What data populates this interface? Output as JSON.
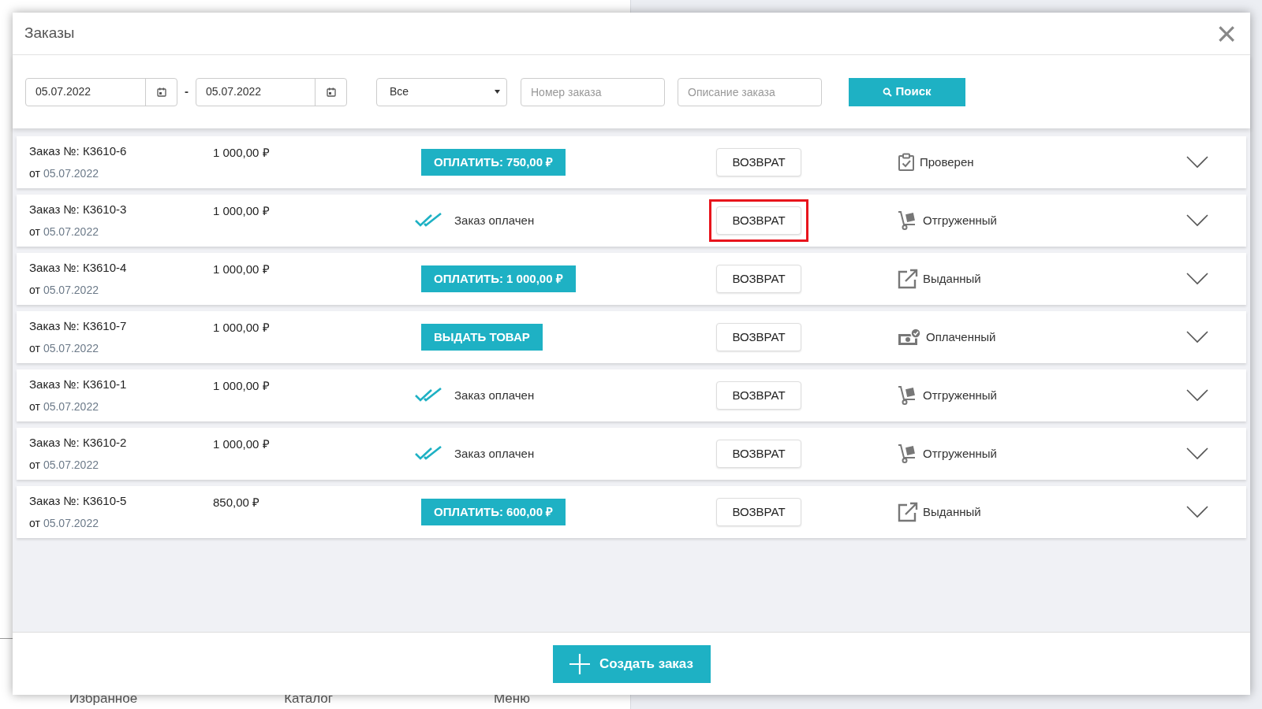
{
  "background_nav": [
    "Избранное",
    "Каталог",
    "Меню"
  ],
  "dialog": {
    "title": "Заказы",
    "close": "×"
  },
  "filters": {
    "date_from": "05.07.2022",
    "separator": "-",
    "date_to": "05.07.2022",
    "status_select": "Все",
    "order_number": {
      "placeholder": "Номер заказа"
    },
    "order_description": {
      "placeholder": "Описание заказа"
    },
    "search_button": "Поиск"
  },
  "orders": [
    {
      "number_label": "Заказ №: К3610-6",
      "date_prefix": "от",
      "date": "05.07.2022",
      "amount": "1 000,00 ₽",
      "action": {
        "kind": "pay",
        "label": "ОПЛАТИТЬ: 750,00 ₽"
      },
      "return_button": "ВОЗВРАТ",
      "highlighted": false,
      "status": {
        "kind": "checked",
        "label": "Проверен"
      }
    },
    {
      "number_label": "Заказ №: К3610-3",
      "date_prefix": "от",
      "date": "05.07.2022",
      "amount": "1 000,00 ₽",
      "action": {
        "kind": "paid",
        "label": "Заказ оплачен"
      },
      "return_button": "ВОЗВРАТ",
      "highlighted": true,
      "status": {
        "kind": "shipped",
        "label": "Отгруженный"
      }
    },
    {
      "number_label": "Заказ №: К3610-4",
      "date_prefix": "от",
      "date": "05.07.2022",
      "amount": "1 000,00 ₽",
      "action": {
        "kind": "pay",
        "label": "ОПЛАТИТЬ: 1 000,00 ₽"
      },
      "return_button": "ВОЗВРАТ",
      "highlighted": false,
      "status": {
        "kind": "issued",
        "label": "Выданный"
      }
    },
    {
      "number_label": "Заказ №: К3610-7",
      "date_prefix": "от",
      "date": "05.07.2022",
      "amount": "1 000,00 ₽",
      "action": {
        "kind": "pay",
        "label": "ВЫДАТЬ ТОВАР"
      },
      "return_button": "ВОЗВРАТ",
      "highlighted": false,
      "status": {
        "kind": "paid",
        "label": "Оплаченный"
      }
    },
    {
      "number_label": "Заказ №: К3610-1",
      "date_prefix": "от",
      "date": "05.07.2022",
      "amount": "1 000,00 ₽",
      "action": {
        "kind": "paid",
        "label": "Заказ оплачен"
      },
      "return_button": "ВОЗВРАТ",
      "highlighted": false,
      "status": {
        "kind": "shipped",
        "label": "Отгруженный"
      }
    },
    {
      "number_label": "Заказ №: К3610-2",
      "date_prefix": "от",
      "date": "05.07.2022",
      "amount": "1 000,00 ₽",
      "action": {
        "kind": "paid",
        "label": "Заказ оплачен"
      },
      "return_button": "ВОЗВРАТ",
      "highlighted": false,
      "status": {
        "kind": "shipped",
        "label": "Отгруженный"
      }
    },
    {
      "number_label": "Заказ №: К3610-5",
      "date_prefix": "от",
      "date": "05.07.2022",
      "amount": "850,00 ₽",
      "action": {
        "kind": "pay",
        "label": "ОПЛАТИТЬ: 600,00 ₽"
      },
      "return_button": "ВОЗВРАТ",
      "highlighted": false,
      "status": {
        "kind": "issued",
        "label": "Выданный"
      }
    }
  ],
  "create_button": "Создать заказ"
}
